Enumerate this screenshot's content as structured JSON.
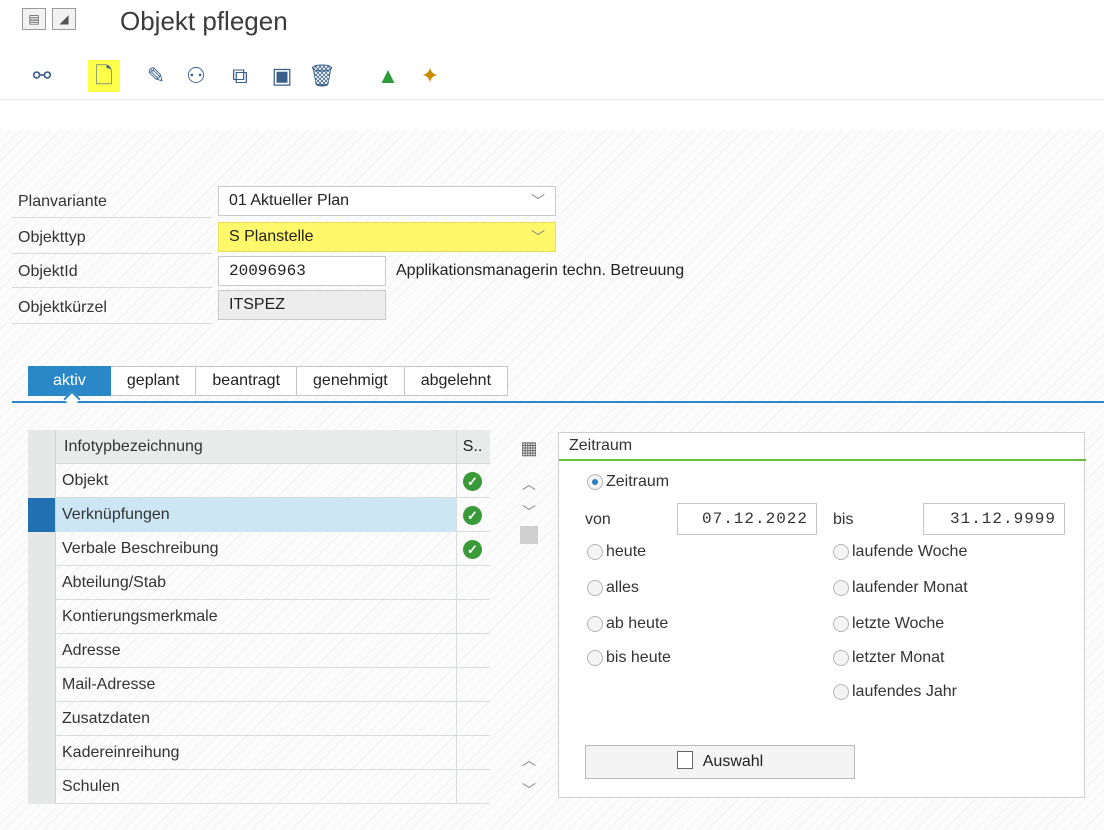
{
  "window": {
    "title": "Objekt pflegen"
  },
  "toolbar": {
    "icons": [
      "glasses-flow-icon",
      "new-document-icon",
      "pencil-icon",
      "display-glasses-icon",
      "copy-icon",
      "delimit-icon",
      "trash-icon",
      "mountains-icon",
      "magic-wand-icon"
    ]
  },
  "header": {
    "planvariante": {
      "label": "Planvariante",
      "value": "01 Aktueller Plan"
    },
    "objekttyp": {
      "label": "Objekttyp",
      "value": "S Planstelle"
    },
    "objektid": {
      "label": "ObjektId",
      "value": "20096963",
      "text": "Applikationsmanagerin techn. Betreuung"
    },
    "objektkuerzel": {
      "label": "Objektkürzel",
      "value": "ITSPEZ"
    }
  },
  "tabs": [
    {
      "label": "aktiv"
    },
    {
      "label": "geplant"
    },
    {
      "label": "beantragt"
    },
    {
      "label": "genehmigt"
    },
    {
      "label": "abgelehnt"
    }
  ],
  "grid": {
    "col_name": "Infotypbezeichnung",
    "col_status": "S..",
    "rows": [
      {
        "name": "Objekt"
      },
      {
        "name": "Verknüpfungen"
      },
      {
        "name": "Verbale Beschreibung"
      },
      {
        "name": "Abteilung/Stab"
      },
      {
        "name": "Kontierungsmerkmale"
      },
      {
        "name": "Adresse"
      },
      {
        "name": "Mail-Adresse"
      },
      {
        "name": "Zusatzdaten"
      },
      {
        "name": "Kadereinreihung"
      },
      {
        "name": "Schulen"
      }
    ]
  },
  "zeitraum": {
    "title": "Zeitraum",
    "radio_zeitraum": "Zeitraum",
    "von_label": "von",
    "von_value": "07.12.2022",
    "bis_label": "bis",
    "bis_value": "31.12.9999",
    "left_options": [
      "heute",
      "alles",
      "ab heute",
      "bis heute"
    ],
    "right_options": [
      "laufende Woche",
      "laufender Monat",
      "letzte Woche",
      "letzter Monat",
      "laufendes Jahr"
    ],
    "button": "Auswahl"
  }
}
